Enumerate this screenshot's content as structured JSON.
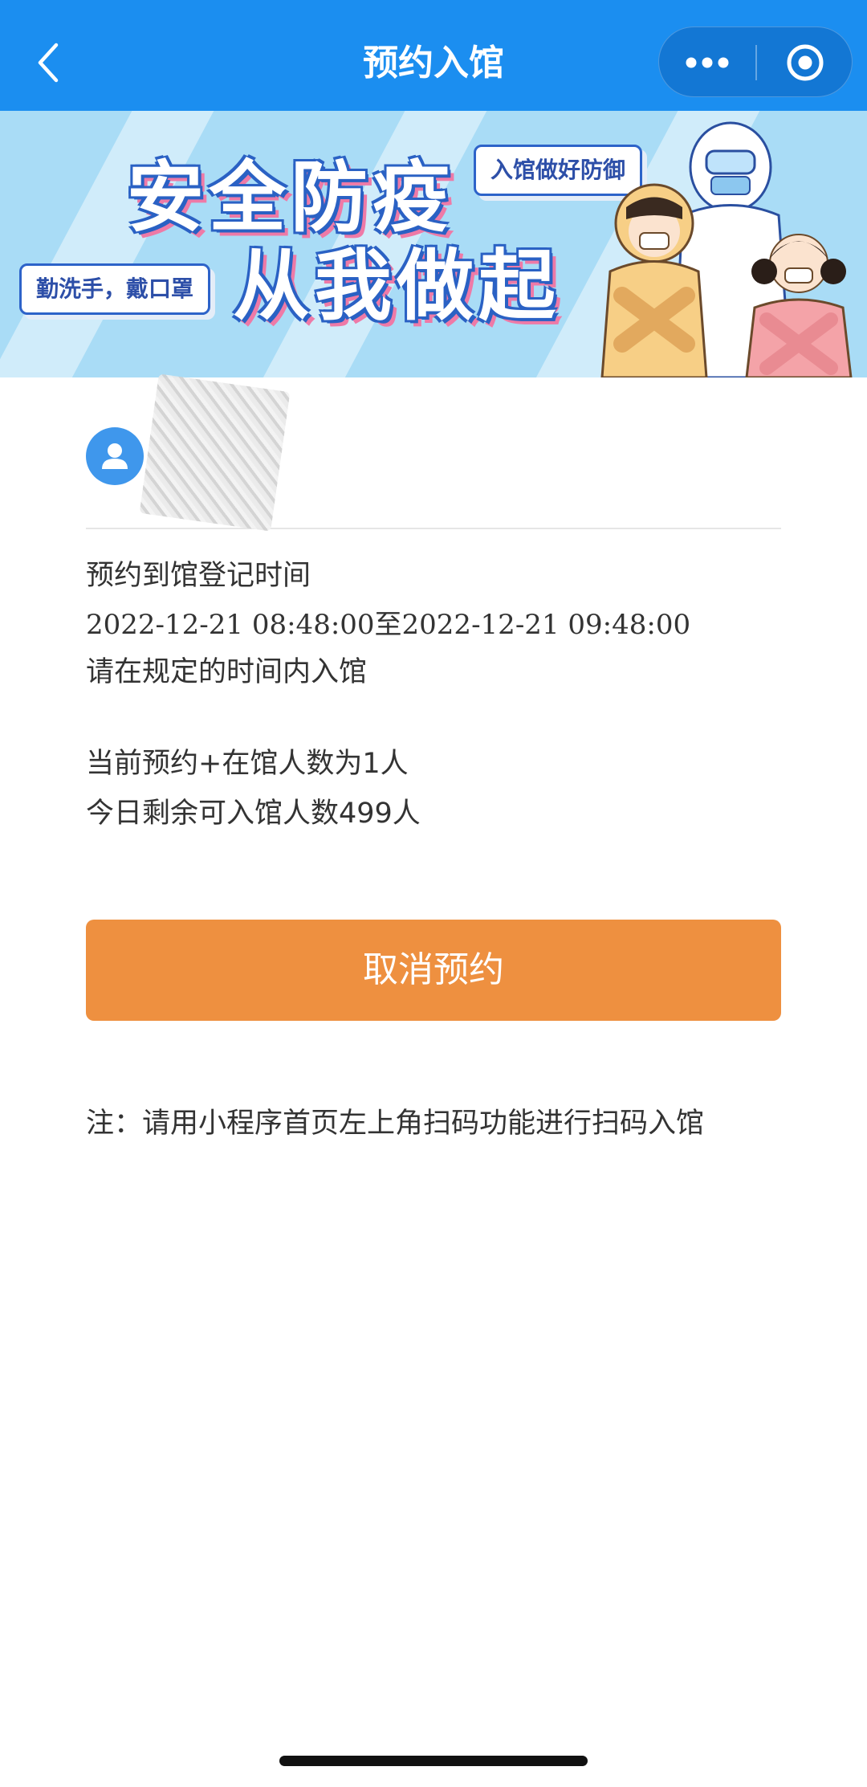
{
  "navbar": {
    "title": "预约入馆",
    "back_icon": "chevron-left-icon",
    "more_icon": "more-dots-icon",
    "close_icon": "miniprogram-close-icon"
  },
  "banner": {
    "headline_line1": "安全防疫",
    "headline_line2": "从我做起",
    "tag_right": "入馆做好防御",
    "tag_left": "勤洗手，戴口罩"
  },
  "user": {
    "avatar_icon": "user-avatar-icon"
  },
  "reservation": {
    "label": "预约到馆登记时间",
    "time_range": "2022-12-21 08:48:00至2022-12-21 09:48:00",
    "instruction": "请在规定的时间内入馆",
    "current_count": "当前预约+在馆人数为1人",
    "remaining": "今日剩余可入馆人数499人"
  },
  "actions": {
    "cancel_label": "取消预约"
  },
  "note": {
    "text": "注：请用小程序首页左上角扫码功能进行扫码入馆"
  },
  "colors": {
    "navbar": "#1b8ef0",
    "banner_bg": "#a9dcf6",
    "button": "#ee9040",
    "avatar": "#3f97ec"
  }
}
